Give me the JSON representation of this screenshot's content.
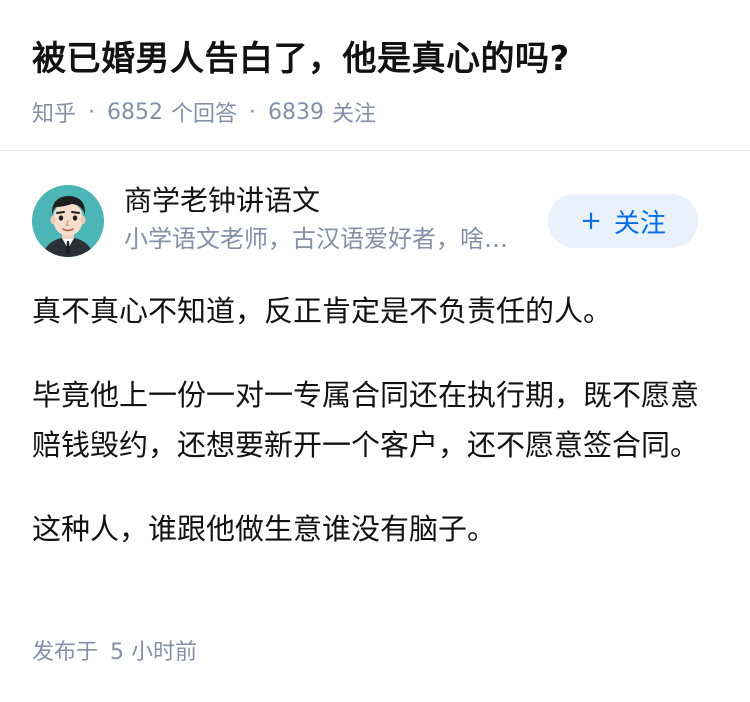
{
  "question": {
    "title": "被已婚男人告白了，他是真心的吗?",
    "source": "知乎",
    "separator": "·",
    "answer_count": "6852",
    "answer_label": "个回答",
    "follower_count": "6839",
    "follower_label": "关注"
  },
  "author": {
    "name": "商学老钟讲语文",
    "bio": "小学语文老师，古汉语爱好者，啥…",
    "avatar_icon": "avatar-cartoon-man",
    "follow_button": {
      "icon": "plus-icon",
      "plus_symbol": "+",
      "label": "关注"
    }
  },
  "answer": {
    "paragraphs": [
      "真不真心不知道，反正肯定是不负责任的人。",
      "毕竟他上一份一对一专属合同还在执行期，既不愿意赔钱毁约，还想要新开一个客户，还不愿意签合同。",
      "这种人，谁跟他做生意谁没有脑子。"
    ],
    "published_label": "发布于",
    "published_time": "5 小时前"
  },
  "colors": {
    "text_primary": "#121212",
    "text_secondary": "#8590a6",
    "accent": "#056de8",
    "accent_bg": "#e8f1fc",
    "avatar_bg": "#4cb6b7"
  }
}
